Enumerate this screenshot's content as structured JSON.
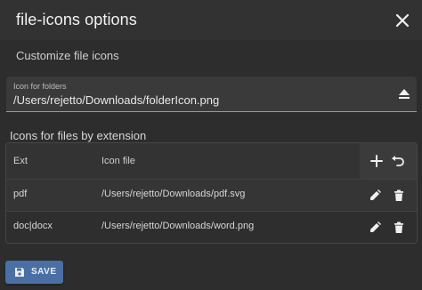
{
  "dialog": {
    "title": "file-icons options",
    "subtitle": "Customize file icons"
  },
  "folder_field": {
    "label": "Icon for folders",
    "value": "/Users/rejetto/Downloads/folderIcon.png"
  },
  "extensions": {
    "section_label": "Icons for files by extension",
    "columns": [
      "Ext",
      "Icon file"
    ],
    "rows": [
      {
        "ext": "pdf",
        "icon_file": "/Users/rejetto/Downloads/pdf.svg"
      },
      {
        "ext": "doc|docx",
        "icon_file": "/Users/rejetto/Downloads/word.png"
      }
    ]
  },
  "actions": {
    "save_label": "SAVE"
  },
  "icons": {
    "close": "close-icon",
    "eject": "eject-icon",
    "add": "plus-icon",
    "undo": "undo-icon",
    "edit": "pencil-icon",
    "delete": "trash-icon",
    "save": "floppy-icon"
  },
  "colors": {
    "background": "#2d2d2d",
    "primary": "#4a6fa5",
    "text": "#e6e6e6"
  }
}
